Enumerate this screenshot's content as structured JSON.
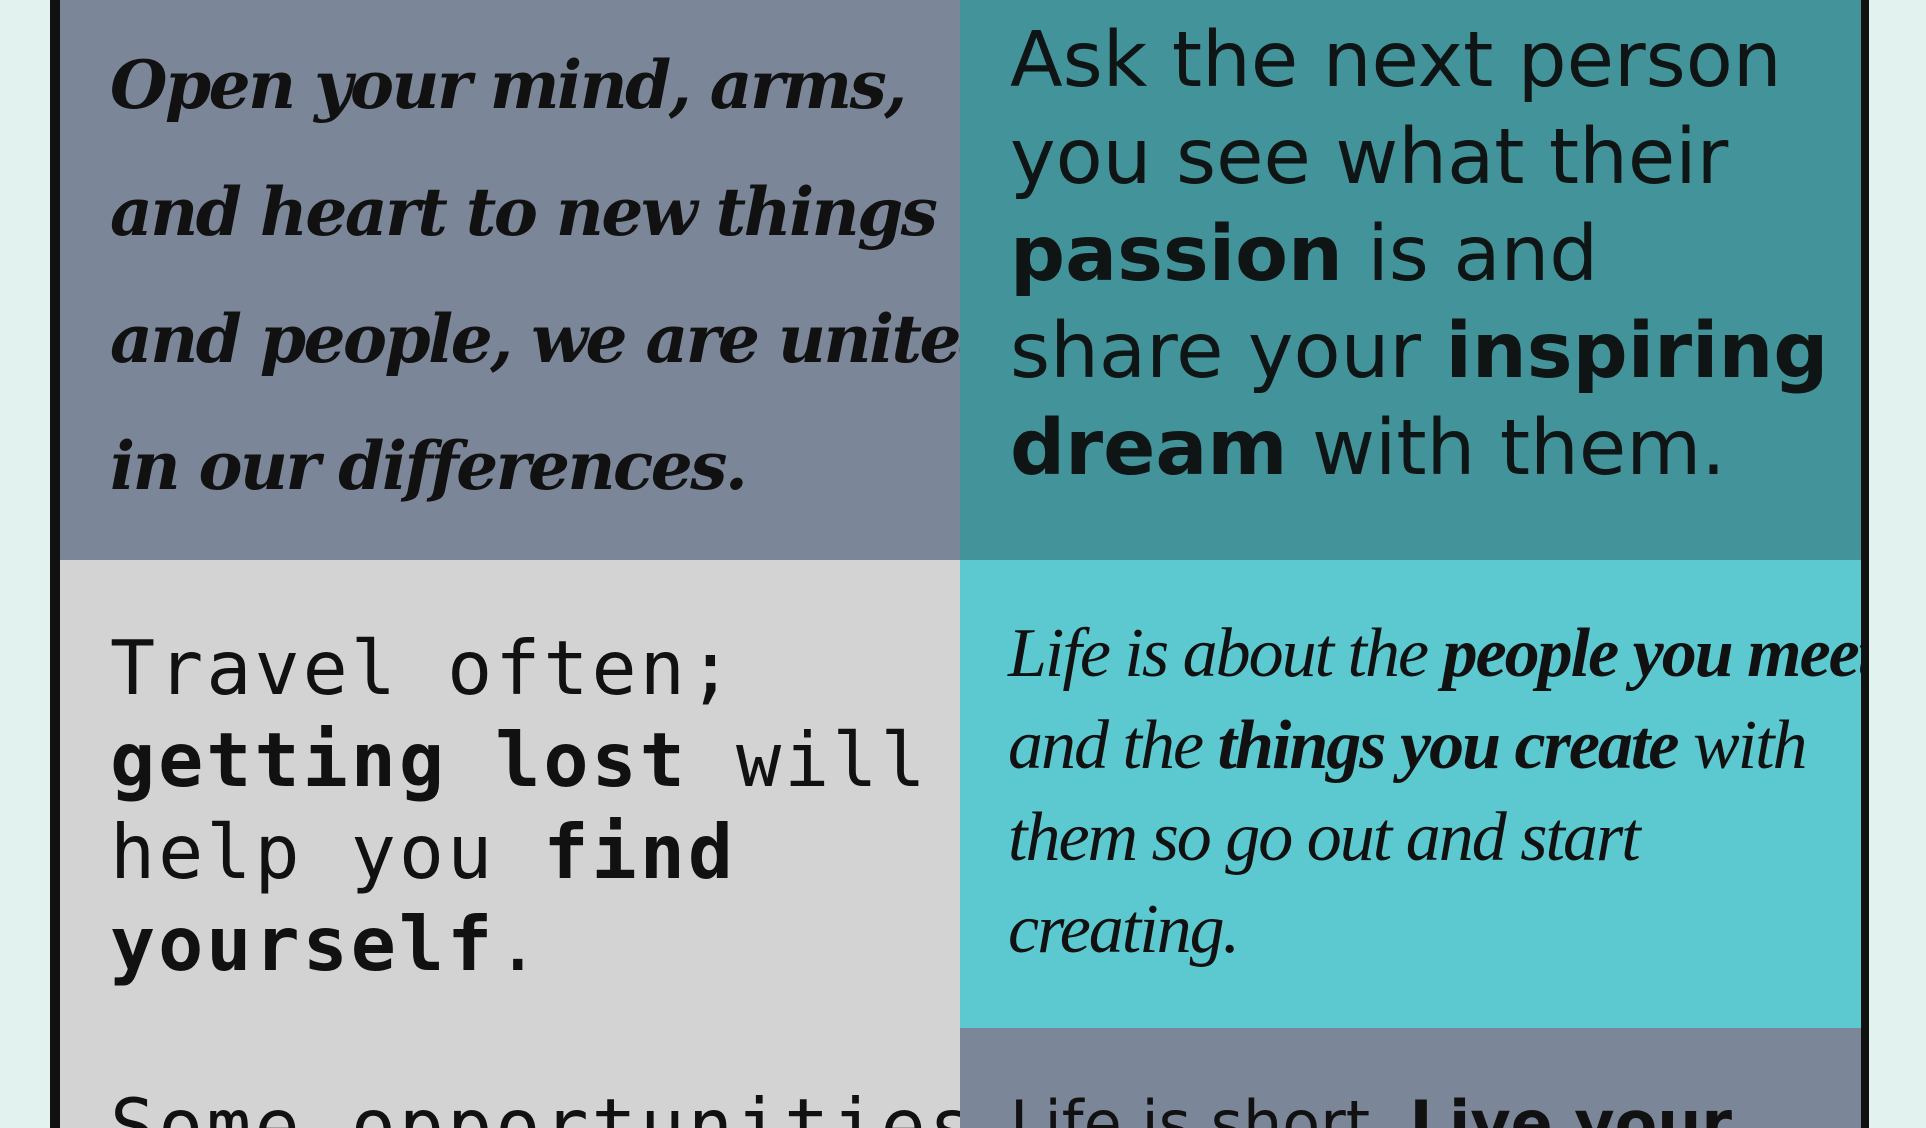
{
  "tiles": {
    "mind": {
      "lines": [
        "Open your mind, arms,",
        "and heart to new things",
        "and people, we are united",
        "in our differences."
      ],
      "color": "#7b8799"
    },
    "passion": {
      "line1": "Ask the next person",
      "line2": "you see what their",
      "line3_bold": "passion",
      "line3_rest": " is and",
      "line4_start": "share your ",
      "line4_bold": "inspiring",
      "line5_bold": "dream",
      "line5_rest": " with them.",
      "color": "#43939a"
    },
    "travel": {
      "line1": "Travel often;",
      "line2_bold": "getting lost",
      "line2_rest": " will",
      "line3_start": "help you ",
      "line3_bold": "find",
      "line4_bold": "yourself",
      "line4_rest": ".",
      "next_partial": "Some opportunities",
      "color": "#d3d3d3"
    },
    "life": {
      "line1_start": "Life is about the ",
      "line1_bold": "people you meet,",
      "line2_start": "and the ",
      "line2_bold": "things you create",
      "line2_rest": " with",
      "line3": "them so go out and start",
      "line4": "creating.",
      "color": "#5bc9cf"
    },
    "short": {
      "line1_start": "Life is short. ",
      "line1_bold": "Live your",
      "color": "#7b8799"
    }
  }
}
